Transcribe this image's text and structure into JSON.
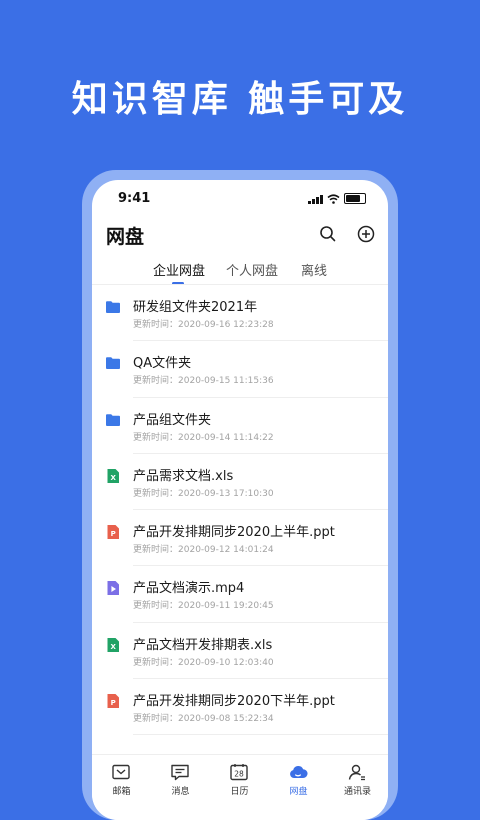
{
  "headline": "知识智库 触手可及",
  "status": {
    "time": "9:41"
  },
  "header": {
    "title": "网盘"
  },
  "tabs": [
    {
      "label": "企业网盘",
      "active": true
    },
    {
      "label": "个人网盘",
      "active": false
    },
    {
      "label": "离线",
      "active": false
    }
  ],
  "meta_prefix": "更新时间：",
  "files": [
    {
      "name": "研发组文件夹2021年",
      "updated": "2020-09-16 12:23:28",
      "type": "folder"
    },
    {
      "name": "QA文件夹",
      "updated": "2020-09-15 11:15:36",
      "type": "folder"
    },
    {
      "name": "产品组文件夹",
      "updated": "2020-09-14 11:14:22",
      "type": "folder"
    },
    {
      "name": "产品需求文档.xls",
      "updated": "2020-09-13 17:10:30",
      "type": "xls"
    },
    {
      "name": "产品开发排期同步2020上半年.ppt",
      "updated": "2020-09-12 14:01:24",
      "type": "ppt"
    },
    {
      "name": "产品文档演示.mp4",
      "updated": "2020-09-11 19:20:45",
      "type": "mp4"
    },
    {
      "name": "产品文档开发排期表.xls",
      "updated": "2020-09-10 12:03:40",
      "type": "xls"
    },
    {
      "name": "产品开发排期同步2020下半年.ppt",
      "updated": "2020-09-08 15:22:34",
      "type": "ppt"
    }
  ],
  "tabbar": [
    {
      "label": "邮箱",
      "icon": "mail-icon",
      "active": false
    },
    {
      "label": "消息",
      "icon": "message-icon",
      "active": false
    },
    {
      "label": "日历",
      "icon": "calendar-icon",
      "active": false,
      "badge": "28"
    },
    {
      "label": "网盘",
      "icon": "cloud-icon",
      "active": true
    },
    {
      "label": "通讯录",
      "icon": "contacts-icon",
      "active": false
    }
  ],
  "colors": {
    "brand": "#3b6fe6",
    "folder": "#3b78e7",
    "xls": "#21a366",
    "ppt": "#e8604c",
    "mp4": "#7b6fe6"
  }
}
